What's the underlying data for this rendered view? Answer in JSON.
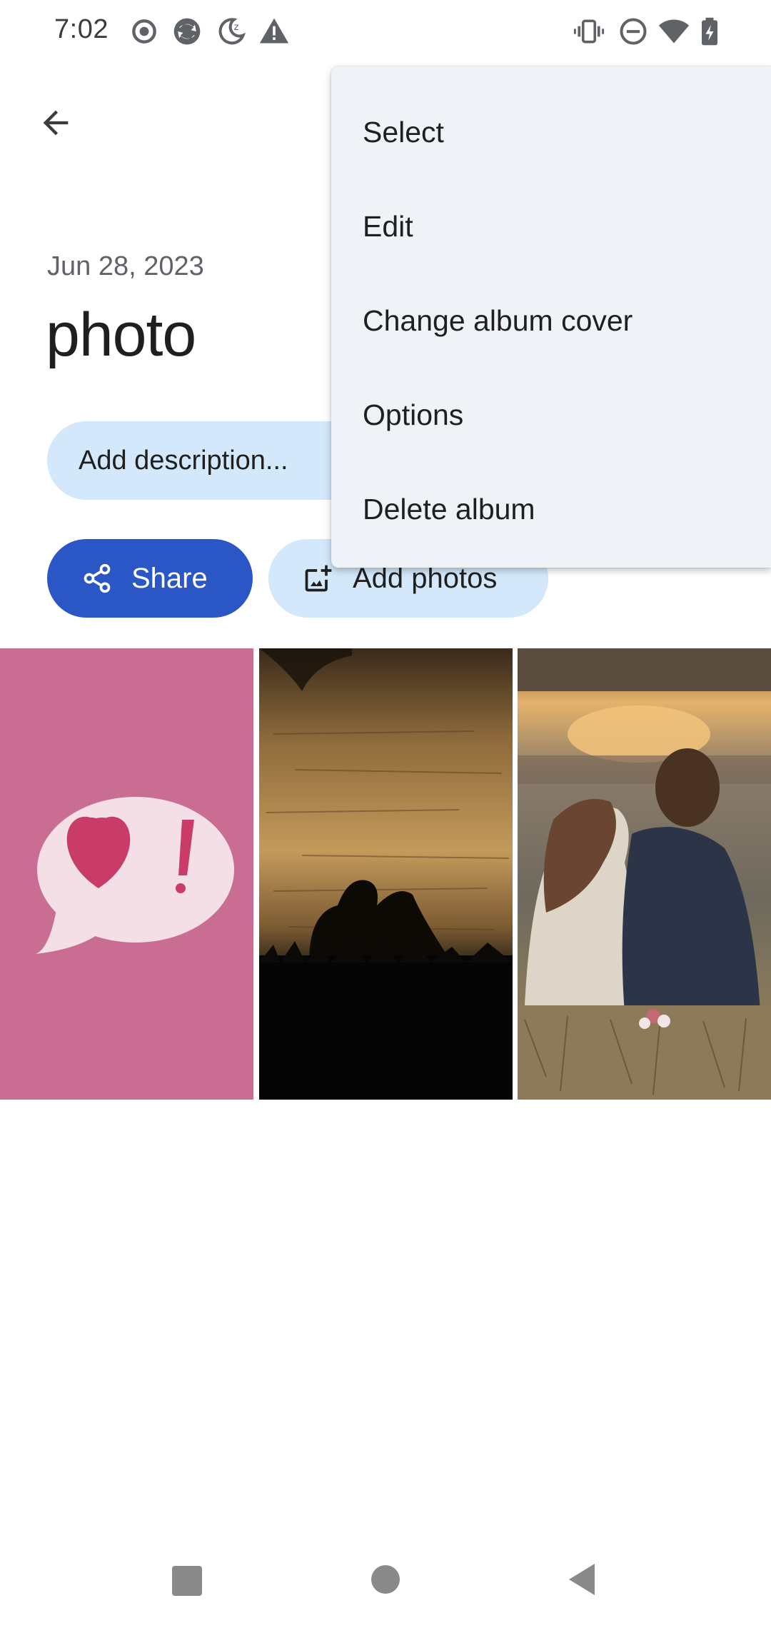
{
  "status_bar": {
    "time": "7:02",
    "left_icons": [
      "record-icon",
      "sync-icon",
      "do-not-disturb-moon-icon",
      "warning-icon"
    ],
    "right_icons": [
      "vibrate-icon",
      "dnd-icon",
      "wifi-icon",
      "battery-charging-icon"
    ]
  },
  "header": {
    "back_icon": "arrow-back-icon"
  },
  "album": {
    "date": "Jun 28, 2023",
    "title": "photo"
  },
  "actions": {
    "add_description": "Add description...",
    "share_label": "Share",
    "share_icon": "share-icon",
    "add_photos_label": "Add photos",
    "add_photos_icon": "add-photo-icon"
  },
  "photos": [
    {
      "name": "love-speech-bubble"
    },
    {
      "name": "couple-silhouette-lake"
    },
    {
      "name": "couple-sunset"
    }
  ],
  "menu": {
    "items": [
      {
        "label": "Select"
      },
      {
        "label": "Edit"
      },
      {
        "label": "Change album cover"
      },
      {
        "label": "Options"
      },
      {
        "label": "Delete album"
      }
    ]
  },
  "nav_bar": {
    "icons": [
      "recents-square-icon",
      "home-circle-icon",
      "back-triangle-icon"
    ]
  },
  "colors": {
    "accent": "#2a56c6",
    "chip": "#d3e8fb",
    "menu_bg": "#eff2f6"
  }
}
